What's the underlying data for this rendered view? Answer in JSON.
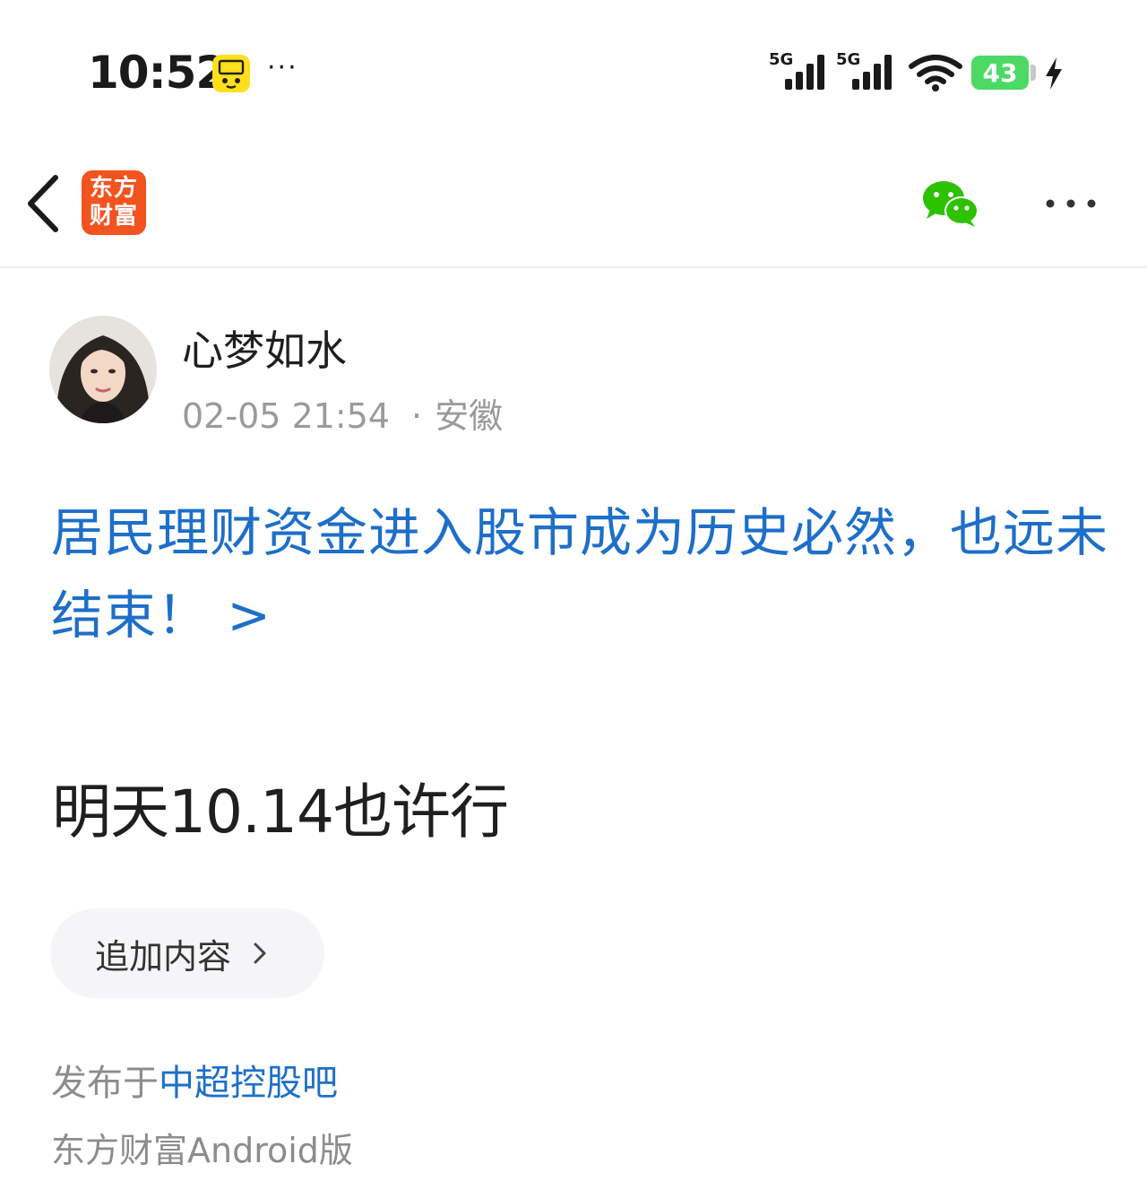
{
  "status_bar": {
    "time": "10:52",
    "app_icon": "xianyu-app-icon",
    "more_dots": "···",
    "signal_1_label": "5G",
    "signal_2_label": "5G",
    "battery_level": "43",
    "charging": true
  },
  "nav": {
    "back_icon": "chevron-left-icon",
    "logo_line1": "东方",
    "logo_line2": "财富",
    "share_icon": "wechat-icon",
    "more_icon": "more-horizontal-icon"
  },
  "post": {
    "author": "心梦如水",
    "date": "02-05 21:54",
    "separator": "·",
    "location": "安徽",
    "title": "居民理财资金进入股市成为历史必然，也远未结束！ >",
    "body": "明天10.14也许行",
    "append_label": "追加内容",
    "publish_prefix": "发布于",
    "forum_name": "中超控股吧",
    "client": "东方财富Android版"
  },
  "colors": {
    "link_blue": "#1d6fc9",
    "brand_orange": "#f2531f",
    "wechat_green": "#2dc100",
    "battery_green": "#4cd964"
  }
}
